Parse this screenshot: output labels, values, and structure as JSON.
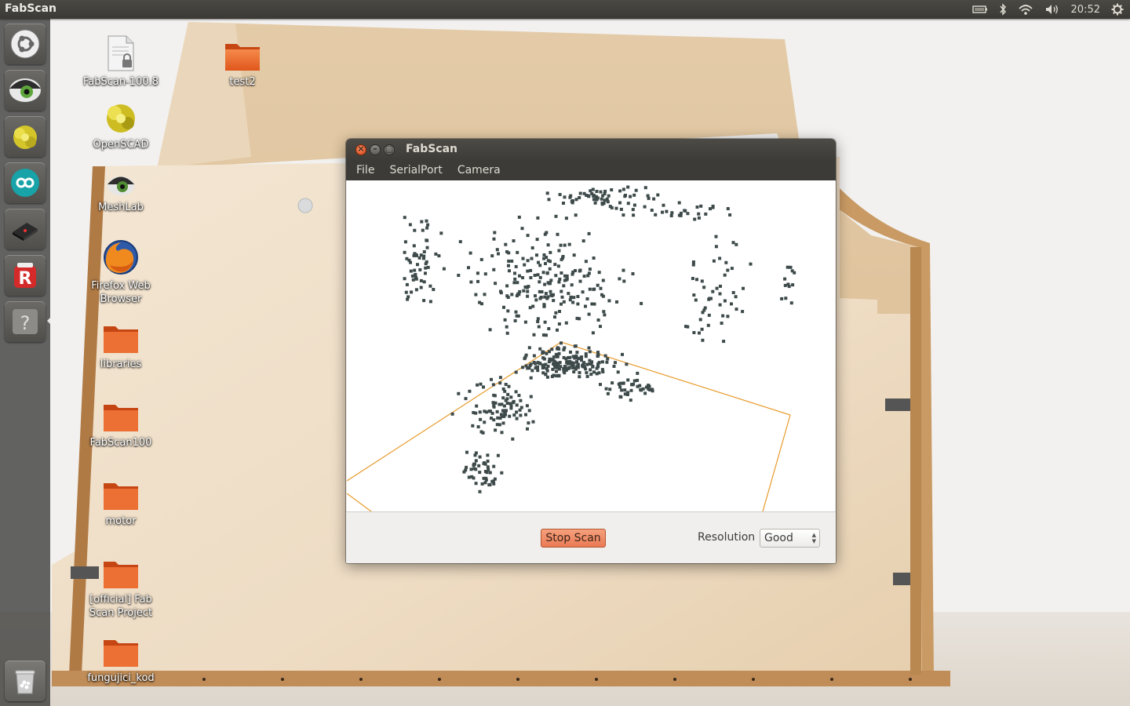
{
  "top_panel": {
    "app_title": "FabScan",
    "clock": "20:52",
    "indicators": [
      "battery-icon",
      "bluetooth-icon",
      "wifi-icon",
      "volume-icon",
      "power-gear-icon"
    ]
  },
  "launcher": {
    "items": [
      {
        "name": "dash-home",
        "icon": "ubuntu-logo-icon"
      },
      {
        "name": "meshlab",
        "icon": "eye-icon"
      },
      {
        "name": "openscad",
        "icon": "openscad-icon"
      },
      {
        "name": "arduino",
        "icon": "arduino-icon"
      },
      {
        "name": "fabscan",
        "icon": "laser-scanner-icon"
      },
      {
        "name": "app-r",
        "icon": "r-app-icon"
      },
      {
        "name": "unknown-app",
        "icon": "question-icon"
      }
    ],
    "trash_icon": "trash-icon"
  },
  "desktop": {
    "icons": [
      {
        "label": "FabScan-100.8",
        "icon": "locked-file-icon"
      },
      {
        "label": "test2",
        "icon": "folder-icon"
      },
      {
        "label": "OpenSCAD",
        "icon": "openscad-icon"
      },
      {
        "label": "MeshLab",
        "icon": "eye-icon"
      },
      {
        "label": "Firefox Web Browser",
        "icon": "firefox-icon"
      },
      {
        "label": "libraries",
        "icon": "folder-icon"
      },
      {
        "label": "FabScan100",
        "icon": "folder-icon"
      },
      {
        "label": "motor",
        "icon": "folder-icon"
      },
      {
        "label": "[official] Fab Scan Project",
        "icon": "folder-icon"
      },
      {
        "label": "fungujici_kod",
        "icon": "folder-icon"
      }
    ]
  },
  "window": {
    "title": "FabScan",
    "menu": [
      "File",
      "SerialPort",
      "Camera"
    ],
    "stop_button": "Stop Scan",
    "resolution_label": "Resolution",
    "resolution_value": "Good"
  },
  "colors": {
    "accent": "#ea7a55",
    "panel": "#3c3b37",
    "point": "#3e4a4a",
    "bbox": "#e89a2a"
  }
}
